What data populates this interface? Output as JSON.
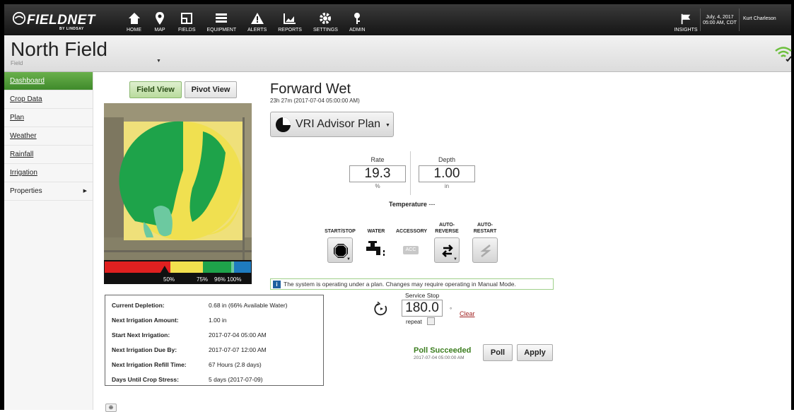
{
  "brand": {
    "name": "FIELDNET",
    "sub": "BY LINDSAY"
  },
  "nav": [
    {
      "label": "HOME",
      "icon": "home-icon"
    },
    {
      "label": "MAP",
      "icon": "map-pin-icon"
    },
    {
      "label": "FIELDS",
      "icon": "fields-icon"
    },
    {
      "label": "EQUIPMENT",
      "icon": "equipment-icon"
    },
    {
      "label": "ALERTS",
      "icon": "alert-icon"
    },
    {
      "label": "REPORTS",
      "icon": "reports-icon"
    },
    {
      "label": "SETTINGS",
      "icon": "gear-icon"
    },
    {
      "label": "ADMIN",
      "icon": "admin-icon"
    }
  ],
  "insights": {
    "label": "INSIGHTS"
  },
  "datetime": {
    "line1": "July, 4, 2017",
    "line2": "05:00 AM, CDT"
  },
  "user": "Kurt Charleson",
  "header": {
    "title": "North Field",
    "subtitle": "Field"
  },
  "sidebar": {
    "items": [
      {
        "label": "Dashboard"
      },
      {
        "label": "Crop Data"
      },
      {
        "label": "Plan"
      },
      {
        "label": "Weather"
      },
      {
        "label": "Rainfall"
      },
      {
        "label": "Irrigation"
      },
      {
        "label": "Properties"
      }
    ]
  },
  "views": {
    "field": "Field View",
    "pivot": "Pivot View"
  },
  "scale": {
    "labels": [
      "50%",
      "75%",
      "96%",
      "100%"
    ],
    "marker_percent": 0.41
  },
  "status": {
    "title": "Forward Wet",
    "sub": "23h 27m (2017-07-04 05:00:00 AM)"
  },
  "plan": {
    "label": "VRI Advisor Plan"
  },
  "rate": {
    "label": "Rate",
    "value": "19.3",
    "unit": "%"
  },
  "depth": {
    "label": "Depth",
    "value": "1.00",
    "unit": "in"
  },
  "temperature": {
    "label": "Temperature",
    "value": "---"
  },
  "controls": {
    "start_stop": "START/STOP",
    "water": "WATER",
    "accessory": "ACCESSORY",
    "acc_badge": "ACC",
    "auto_reverse": "AUTO-\nREVERSE",
    "auto_restart": "AUTO-\nRESTART"
  },
  "notice": "The system is operating under a plan. Changes may require operating in Manual Mode.",
  "info": [
    {
      "k": "Current Depletion:",
      "v": "0.68 in (66% Available Water)"
    },
    {
      "k": "Next Irrigation Amount:",
      "v": "1.00 in"
    },
    {
      "k": "Start Next Irrigation:",
      "v": "2017-07-04 05:00 AM"
    },
    {
      "k": "Next Irrigation Due By:",
      "v": "2017-07-07 12:00 AM"
    },
    {
      "k": "Next Irrigation Refill Time:",
      "v": "67 Hours (2.8 days)"
    },
    {
      "k": "Days Until Crop Stress:",
      "v": "5 days (2017-07-09)"
    }
  ],
  "service_stop": {
    "label": "Service Stop",
    "value": "180.0",
    "deg": "°",
    "clear": "Clear",
    "repeat": "repeat"
  },
  "poll": {
    "status": "Poll Succeeded",
    "ts": "2017-07-04 05:00:00 AM",
    "poll_btn": "Poll",
    "apply_btn": "Apply"
  },
  "zoom": {
    "label": "⊕"
  },
  "colors": {
    "accent": "#4a9a35",
    "green": "#1ea34a",
    "yellow": "#f2e04e",
    "red": "#e02020",
    "blue": "#1e7bbf"
  }
}
